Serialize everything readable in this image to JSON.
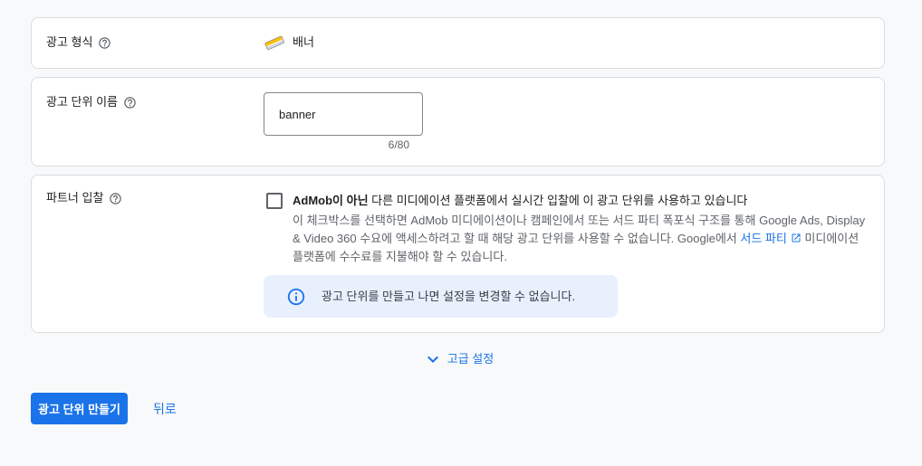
{
  "colors": {
    "primary": "#1a73e8",
    "text": "#202124",
    "secondary_text": "#5f6368",
    "border": "#dadce0",
    "info_background": "#e8f0fe",
    "page_background": "#f8f9fa"
  },
  "ad_format": {
    "label": "광고 형식",
    "help_icon": "help-outline-icon",
    "value_icon": "banner-icon",
    "value": "배너"
  },
  "ad_unit_name": {
    "label": "광고 단위 이름",
    "help_icon": "help-outline-icon",
    "value": "banner",
    "counter": "6/80"
  },
  "partner_bidding": {
    "label": "파트너 입찰",
    "help_icon": "help-outline-icon",
    "checked": false,
    "checkbox_label_bold": "AdMob이 아닌",
    "checkbox_label_rest": " 다른 미디에이션 플랫폼에서 실시간 입찰에 이 광고 단위를 사용하고 있습니다",
    "description_before_link": "이 체크박스를 선택하면 AdMob 미디에이션이나 캠페인에서 또는 서드 파티 폭포식 구조를 통해 Google Ads, Display & Video 360 수요에 액세스하려고 할 때 해당 광고 단위를 사용할 수 없습니다. Google에서 ",
    "link_text": "서드 파티",
    "link_icon": "open-in-new-icon",
    "description_after_link": " 미디에이션 플랫폼에 수수료를 지불해야 할 수 있습니다.",
    "info_icon": "info-outline-icon",
    "info_message": "광고 단위를 만들고 나면 설정을 변경할 수 없습니다."
  },
  "advanced_settings": {
    "icon": "chevron-down-icon",
    "label": "고급 설정"
  },
  "actions": {
    "create_label": "광고 단위 만들기",
    "back_label": "뒤로"
  }
}
